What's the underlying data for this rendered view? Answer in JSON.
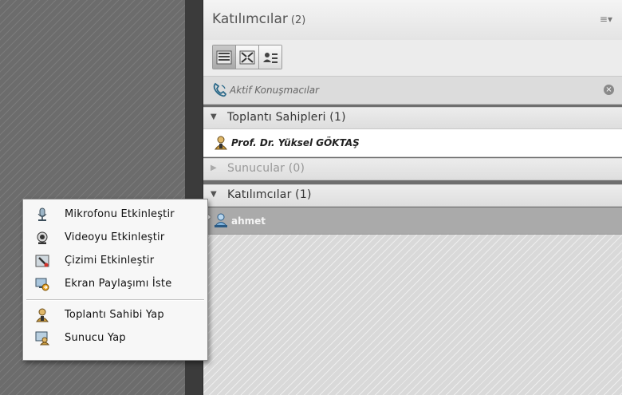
{
  "panel": {
    "title": "Katılımcılar",
    "count": "(2)",
    "menu_icon": "≡▾"
  },
  "view_buttons": [
    "list-view-icon",
    "grid-view-icon",
    "detail-view-icon"
  ],
  "active_speakers": {
    "label": "Aktif Konuşmacılar",
    "icon": "phone-icon",
    "clear_icon": "×"
  },
  "sections": {
    "hosts": {
      "label": "Toplantı Sahipleri (1)",
      "arrow": "▼"
    },
    "presenters": {
      "label": "Sunucular (0)",
      "arrow": "▶"
    },
    "participants": {
      "label": "Katılımcılar (1)",
      "arrow": "▼"
    }
  },
  "hosts": [
    {
      "name": "Prof. Dr. Yüksel GÖKTAŞ",
      "icon": "host-user-icon"
    }
  ],
  "participants": [
    {
      "name": "ahmet",
      "icon": "participant-user-icon"
    }
  ],
  "context_menu": {
    "items": [
      {
        "label": "Mikrofonu Etkinleştir",
        "icon": "microphone-icon"
      },
      {
        "label": "Videoyu Etkinleştir",
        "icon": "webcam-icon"
      },
      {
        "label": "Çizimi Etkinleştir",
        "icon": "drawing-icon"
      },
      {
        "label": "Ekran Paylaşımı İste",
        "icon": "screen-share-icon"
      },
      {
        "label": "Toplantı Sahibi Yap",
        "icon": "make-host-icon"
      },
      {
        "label": "Sunucu Yap",
        "icon": "make-presenter-icon"
      }
    ]
  },
  "colors": {
    "background_dark": "#6c6c6c",
    "panel_header": "#ececec",
    "selected_row": "#aaaaaa",
    "menu_bg": "#f7f7f7"
  }
}
